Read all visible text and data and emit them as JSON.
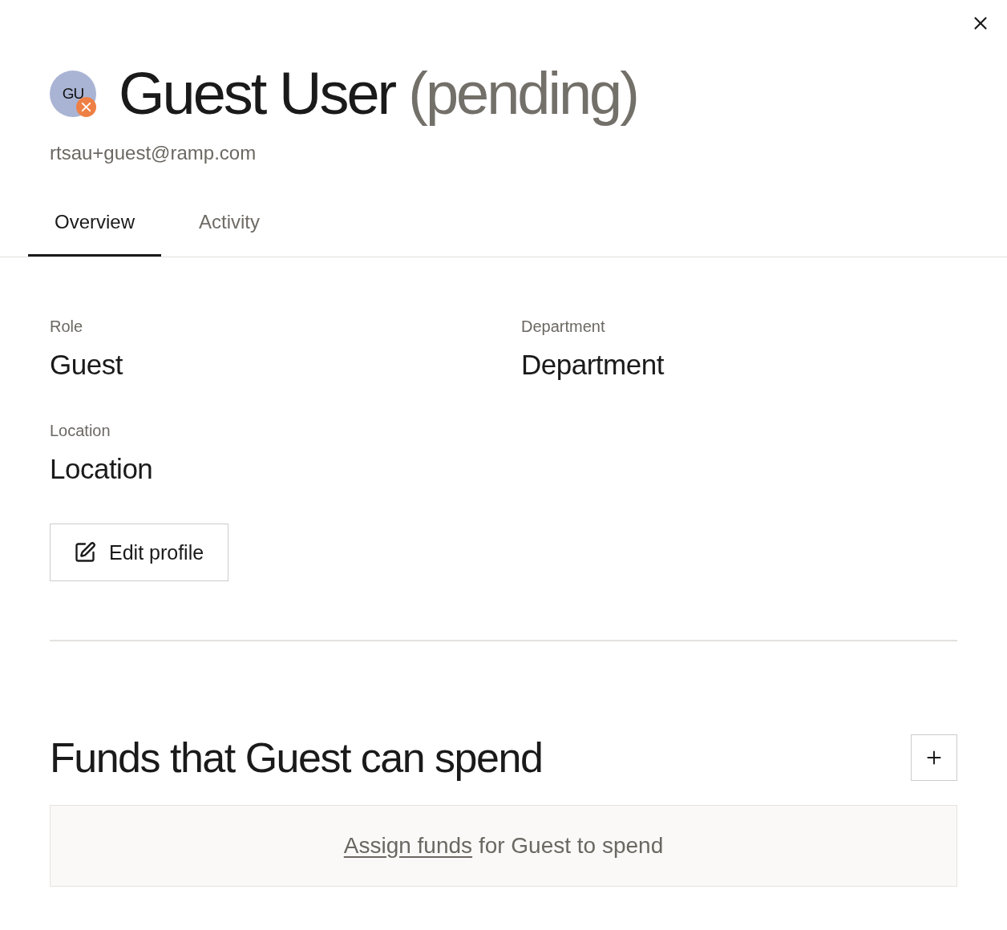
{
  "header": {
    "avatar": {
      "initials": "GU",
      "pending": true
    },
    "name": "Guest User",
    "status_label": "(pending)",
    "email": "rtsau+guest@ramp.com"
  },
  "tabs": [
    {
      "label": "Overview",
      "selected": true
    },
    {
      "label": "Activity",
      "selected": false
    }
  ],
  "fields": [
    {
      "label": "Role",
      "value": "Guest"
    },
    {
      "label": "Department",
      "value": "Department"
    },
    {
      "label": "Location",
      "value": "Location"
    }
  ],
  "edit_button": {
    "label": "Edit profile"
  },
  "funds": {
    "title": "Funds that Guest can spend",
    "empty_state": {
      "link": "Assign funds",
      "text": "for Guest to spend"
    }
  }
}
